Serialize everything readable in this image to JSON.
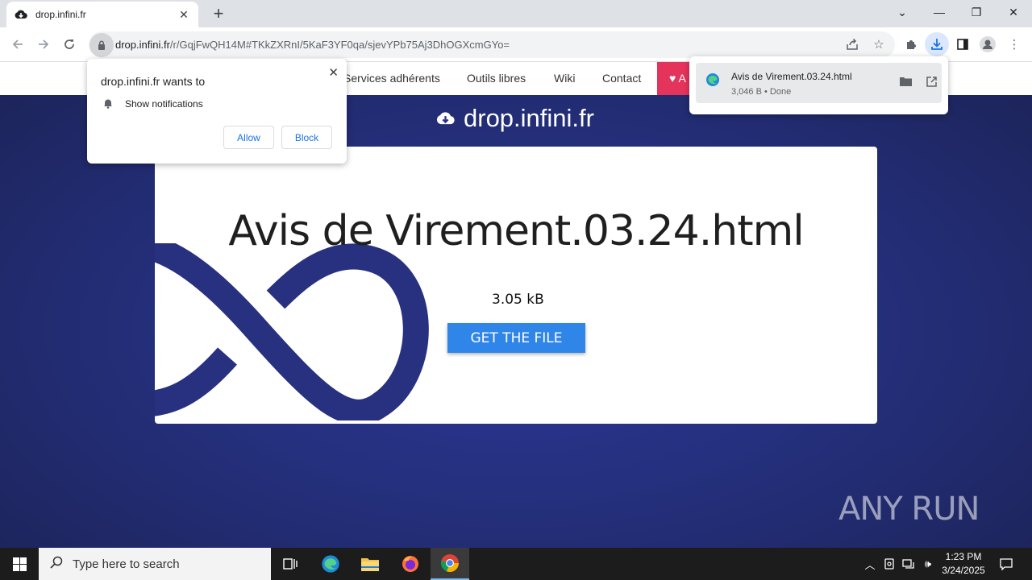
{
  "browser": {
    "tab_title": "drop.infini.fr",
    "new_tab": "+",
    "url_host": "drop.infini.fr",
    "url_path": "/r/GqjFwQH14M#TKkZXRnI/5KaF3YF0qa/sjevYPb75Aj3DhOGXcmGYo="
  },
  "site": {
    "nav": [
      "Services adhérents",
      "Outils libres",
      "Wiki",
      "Contact"
    ],
    "heart_label": "A",
    "logo_text": "drop.infini.fr",
    "file_name": "Avis de Virement.03.24.html",
    "file_size": "3.05 kB",
    "get_button": "GET THE FILE"
  },
  "notification_prompt": {
    "title": "drop.infini.fr wants to",
    "permission": "Show notifications",
    "allow": "Allow",
    "block": "Block"
  },
  "download": {
    "name": "Avis de Virement.03.24.html",
    "status": "3,046 B • Done"
  },
  "watermark": "ANY RUN",
  "taskbar": {
    "search_placeholder": "Type here to search",
    "time": "1:23 PM",
    "date": "3/24/2025"
  },
  "colors": {
    "page_bg": "#25307e",
    "button_blue": "#2f86e8",
    "heart_pink": "#e5345b",
    "infinity_navy": "#27317f"
  }
}
